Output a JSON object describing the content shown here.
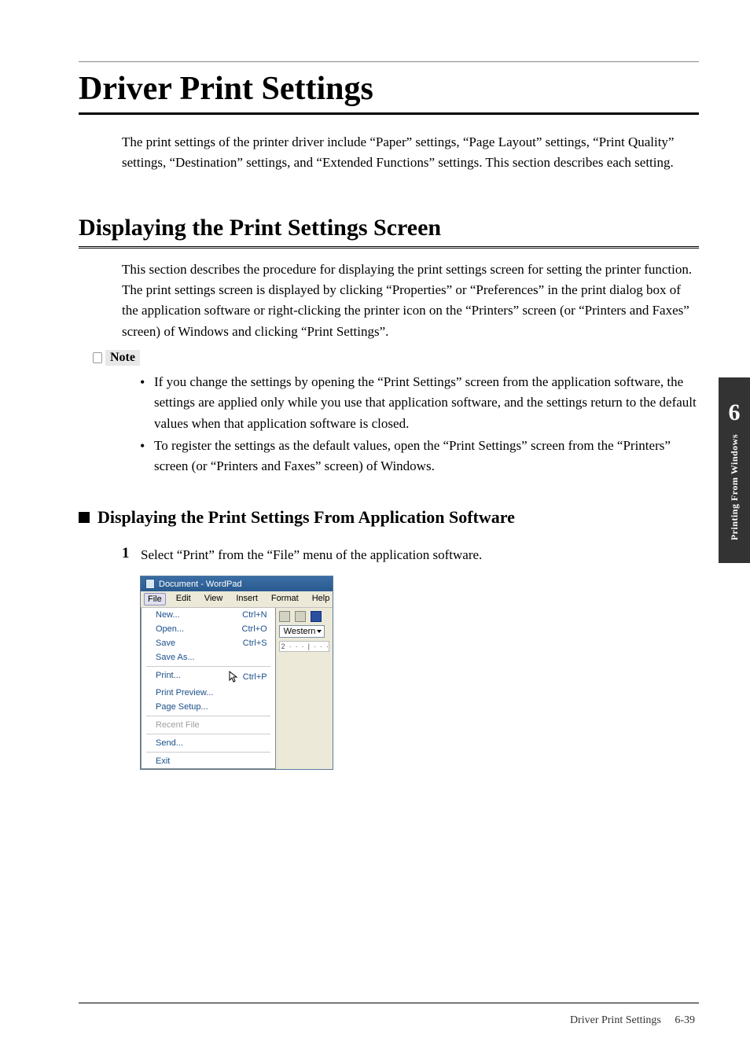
{
  "page": {
    "title": "Driver Print Settings",
    "intro": "The print settings of the printer driver include “Paper” settings, “Page Layout” settings, “Print Quality” settings, “Destination” settings, and “Extended Functions” settings. This section describes each setting."
  },
  "section": {
    "title": "Displaying the Print Settings Screen",
    "body": "This section describes the procedure for displaying the print settings screen for setting the printer function.\nThe print settings screen is displayed by clicking “Properties” or “Preferences” in the print dialog box of the application software or right-clicking the printer icon on the “Printers” screen (or “Printers and Faxes” screen) of Windows and clicking “Print Settings”."
  },
  "note": {
    "label": "Note",
    "bullets": [
      "If you change the settings by opening the “Print Settings” screen from the application software, the settings are applied only while you use that application software, and the settings return to the default values when that application software is closed.",
      "To register the settings as the default values, open the “Print Settings” screen from the “Printers” screen (or “Printers and Faxes” screen) of Windows."
    ]
  },
  "subsection": {
    "title": "Displaying the Print Settings From Application Software"
  },
  "step1": {
    "number": "1",
    "text": "Select “Print” from the “File” menu of the application software."
  },
  "wordpad": {
    "title": "Document - WordPad",
    "menus": [
      "File",
      "Edit",
      "View",
      "Insert",
      "Format",
      "Help"
    ],
    "right_select": "Western",
    "ruler_start": "2",
    "items": [
      {
        "label": "New...",
        "shortcut": "Ctrl+N"
      },
      {
        "label": "Open...",
        "shortcut": "Ctrl+O"
      },
      {
        "label": "Save",
        "shortcut": "Ctrl+S"
      },
      {
        "label": "Save As...",
        "shortcut": ""
      }
    ],
    "items2": [
      {
        "label": "Print...",
        "shortcut": "Ctrl+P"
      },
      {
        "label": "Print Preview...",
        "shortcut": ""
      },
      {
        "label": "Page Setup...",
        "shortcut": ""
      }
    ],
    "items3": [
      {
        "label": "Recent File"
      }
    ],
    "items4": [
      {
        "label": "Send..."
      }
    ],
    "items5": [
      {
        "label": "Exit"
      }
    ]
  },
  "side_tab": {
    "chapter": "6",
    "label": "Printing From Windows"
  },
  "footer": {
    "text": "Driver Print Settings",
    "page": "6-39"
  }
}
